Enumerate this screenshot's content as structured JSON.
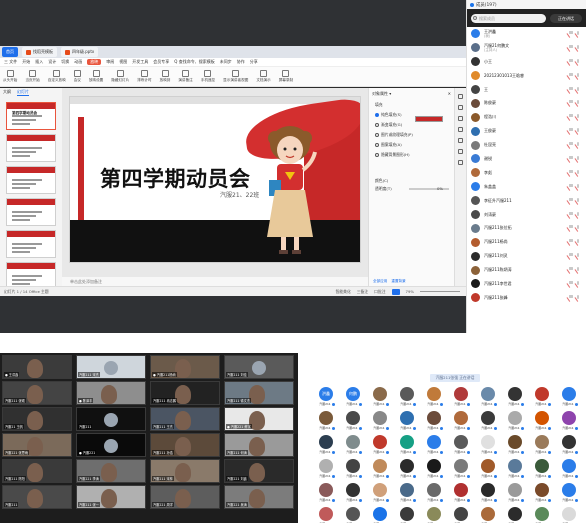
{
  "wps": {
    "tabs": [
      {
        "label": "首页",
        "kind": "home"
      },
      {
        "label": "找稻壳模板",
        "kind": "doc"
      },
      {
        "label": "四年级.pptx",
        "kind": "doc"
      }
    ],
    "menus": [
      "三 文件",
      "开始",
      "插入",
      "设计",
      "切换",
      "动画",
      "放映",
      "审阅",
      "视图",
      "开发工具",
      "会员专享",
      "Q 查找命令、搜索模板",
      "未同步",
      "协作",
      "分享"
    ],
    "menu_active_index": 6,
    "ribbon_buttons": [
      "从头开始",
      "当页开始",
      "自定义放映",
      "会议",
      "放映设置",
      "隐藏幻灯片",
      "排练计时",
      "放映到",
      "演讲备注",
      "手机遥控",
      "显示演讲者视图",
      "文档演示",
      "屏幕录制"
    ],
    "side_tabs": [
      "大纲",
      "幻灯片"
    ],
    "slide_numbers": [
      "1",
      "2",
      "3",
      "4",
      "5",
      "6"
    ],
    "thumb_titles": [
      "第四学期动员会",
      "",
      "",
      "",
      "",
      ""
    ],
    "slide": {
      "title": "第四学期动员会",
      "subtitle": "汽服21、22班"
    },
    "notes_placeholder": "单击此处添加备注",
    "right_panel": {
      "header": "对象属性 ▾",
      "fill_label": "填充",
      "options": [
        {
          "label": "纯色填充(S)",
          "on": true
        },
        {
          "label": "渐变填充(G)",
          "on": false
        },
        {
          "label": "图片或纹理填充(P)",
          "on": false
        },
        {
          "label": "图案填充(A)",
          "on": false
        },
        {
          "label": "隐藏背景图形(H)",
          "on": false
        }
      ],
      "color_label": "颜色(C)",
      "transparency_label": "透明度(T)",
      "transparency_value": "0%",
      "bottom_tabs": [
        "全部应用",
        "重置背景"
      ]
    },
    "status": {
      "left": "幻灯片 1 / 14   Office 主题",
      "right_items": [
        "智能美化",
        "三备注",
        "口批注"
      ],
      "zoom": "79% "
    }
  },
  "participants": {
    "header": "成员(197)",
    "search_placeholder": "搜索成员",
    "talk_label": "正在讲话",
    "items": [
      {
        "name": "王洪鑫",
        "sub": "(我)",
        "color": "#2b7de9"
      },
      {
        "name": "汽服21何鹏文",
        "sub": "(主持人)",
        "color": "#5b6f8a"
      },
      {
        "name": "小王",
        "sub": "",
        "color": "#333333"
      },
      {
        "name": "20212301013王晗睿",
        "sub": "",
        "color": "#e08a2a"
      },
      {
        "name": "王",
        "sub": "",
        "color": "#444444"
      },
      {
        "name": "陈俊豪",
        "sub": "",
        "color": "#6b4b3a"
      },
      {
        "name": "程浩川",
        "sub": "",
        "color": "#8b5a2b"
      },
      {
        "name": "王俊豪",
        "sub": "",
        "color": "#2f6fb0"
      },
      {
        "name": "杜昆亮",
        "sub": "",
        "color": "#7a7a7a"
      },
      {
        "name": "谢锐",
        "sub": "",
        "color": "#3a7bd5"
      },
      {
        "name": "李彪",
        "sub": "",
        "color": "#b06a3b"
      },
      {
        "name": "朱盖盖",
        "sub": "",
        "color": "#2b7de9"
      },
      {
        "name": "李征升汽服211",
        "sub": "",
        "color": "#555555"
      },
      {
        "name": "刘涛豪",
        "sub": "",
        "color": "#4a4a4a"
      },
      {
        "name": "汽服211张位拓",
        "sub": "",
        "color": "#6a7b8c"
      },
      {
        "name": "汽服211杨尚",
        "sub": "",
        "color": "#b35c2e"
      },
      {
        "name": "汽服211刘灵",
        "sub": "",
        "color": "#2c2c2c"
      },
      {
        "name": "汽服211陈炳涛",
        "sub": "",
        "color": "#8c6239"
      },
      {
        "name": "汽服211李世君",
        "sub": "",
        "color": "#1a1a1a"
      },
      {
        "name": "汽服211张峰",
        "sub": "",
        "color": "#c0392b"
      }
    ]
  },
  "video_grid": {
    "cells": [
      {
        "label": "● 王洪鑫",
        "bg": "#3b3b3b",
        "kind": "face"
      },
      {
        "label": "汽服211 宋杰",
        "bg": "#cfd6dc",
        "kind": "avatar"
      },
      {
        "label": "● 汽服211杨尚",
        "bg": "#6b5a4a",
        "kind": "face"
      },
      {
        "label": "汽服211 刘佳",
        "bg": "#5a5a5a",
        "kind": "avatar"
      },
      {
        "label": "汽服211 张硕",
        "bg": "#444444",
        "kind": "face"
      },
      {
        "label": "● 陈泽丰",
        "bg": "#8e8e8e",
        "kind": "face"
      },
      {
        "label": "汽服211 冉志鹏",
        "bg": "#222222",
        "kind": "face"
      },
      {
        "label": "汽服211 徐文杰",
        "bg": "#6d7a85",
        "kind": "face"
      },
      {
        "label": "汽服21 王帆",
        "bg": "#303030",
        "kind": "face"
      },
      {
        "label": "汽服211",
        "bg": "#101010",
        "kind": "avatar"
      },
      {
        "label": "汽服211 王杰",
        "bg": "#4b5563",
        "kind": "face"
      },
      {
        "label": "● 汽服221 黄宇",
        "bg": "#e8e8e8",
        "kind": "face"
      },
      {
        "label": "汽服221 张思雨",
        "bg": "#7b6a5a",
        "kind": "face"
      },
      {
        "label": "● 汽服221",
        "bg": "#0a0a0a",
        "kind": "avatar"
      },
      {
        "label": "汽服211 孙浩",
        "bg": "#5c4a3a",
        "kind": "face"
      },
      {
        "label": "汽服211 何涛",
        "bg": "#9a9a9a",
        "kind": "face"
      },
      {
        "label": "汽服211 陈阳",
        "bg": "#3a3a3a",
        "kind": "face"
      },
      {
        "label": "汽服221 李涛",
        "bg": "#6e6e6e",
        "kind": "face"
      },
      {
        "label": "汽服211 宋林",
        "bg": "#8a7a6a",
        "kind": "face"
      },
      {
        "label": "汽服221 刘鑫",
        "bg": "#2a2a2a",
        "kind": "face"
      },
      {
        "label": "汽服211",
        "bg": "#4a4a4a",
        "kind": "face"
      },
      {
        "label": "汽服211 张一",
        "bg": "#b0b0b0",
        "kind": "face"
      },
      {
        "label": "汽服221 周洋",
        "bg": "#5d5d5d",
        "kind": "face"
      },
      {
        "label": "汽服221 吴涛",
        "bg": "#7c7c7c",
        "kind": "face"
      }
    ]
  },
  "gallery": {
    "tag": "汽服211张强 正在讲话",
    "cells": [
      {
        "text": "洪鑫",
        "color": "#2b7de9"
      },
      {
        "text": "何鹏",
        "color": "#2b7de9"
      },
      {
        "text": "",
        "color": "#8a6a4a"
      },
      {
        "text": "",
        "color": "#5a5a5a"
      },
      {
        "text": "",
        "color": "#c07a3a"
      },
      {
        "text": "",
        "color": "#b03a3a"
      },
      {
        "text": "",
        "color": "#6a8aaa"
      },
      {
        "text": "",
        "color": "#333333"
      },
      {
        "text": "",
        "color": "#c0392b"
      },
      {
        "text": "",
        "color": "#2b7de9"
      },
      {
        "text": "",
        "color": "#7a5a3a"
      },
      {
        "text": "",
        "color": "#4a4a4a"
      },
      {
        "text": "",
        "color": "#888888"
      },
      {
        "text": "",
        "color": "#2e6fb0"
      },
      {
        "text": "",
        "color": "#6b4b3a"
      },
      {
        "text": "",
        "color": "#b06a3b"
      },
      {
        "text": "",
        "color": "#3a3a3a"
      },
      {
        "text": "",
        "color": "#aaaaaa"
      },
      {
        "text": "",
        "color": "#d35400"
      },
      {
        "text": "",
        "color": "#8e44ad"
      },
      {
        "text": "",
        "color": "#2c3e50"
      },
      {
        "text": "",
        "color": "#7f8c8d"
      },
      {
        "text": "",
        "color": "#c0392b"
      },
      {
        "text": "",
        "color": "#16a085"
      },
      {
        "text": "",
        "color": "#2b7de9"
      },
      {
        "text": "",
        "color": "#5a5a5a"
      },
      {
        "text": "",
        "color": "#e0e0e0"
      },
      {
        "text": "",
        "color": "#6a4a2a"
      },
      {
        "text": "",
        "color": "#9a7a5a"
      },
      {
        "text": "",
        "color": "#333333"
      },
      {
        "text": "",
        "color": "#b0b0b0"
      },
      {
        "text": "",
        "color": "#444444"
      },
      {
        "text": "",
        "color": "#c08a5a"
      },
      {
        "text": "",
        "color": "#2b2b2b"
      },
      {
        "text": "",
        "color": "#1a1a1a"
      },
      {
        "text": "",
        "color": "#7a7a7a"
      },
      {
        "text": "",
        "color": "#a05a2a"
      },
      {
        "text": "",
        "color": "#5a7a9a"
      },
      {
        "text": "",
        "color": "#3a5a3a"
      },
      {
        "text": "",
        "color": "#2b7de9"
      },
      {
        "text": "",
        "color": "#8a5a5a"
      },
      {
        "text": "",
        "color": "#333333"
      },
      {
        "text": "",
        "color": "#d0a07a"
      },
      {
        "text": "",
        "color": "#4a6a8a"
      },
      {
        "text": "",
        "color": "#6a6a6a"
      },
      {
        "text": "",
        "color": "#b03030"
      },
      {
        "text": "",
        "color": "#2a2a2a"
      },
      {
        "text": "",
        "color": "#9a9a9a"
      },
      {
        "text": "",
        "color": "#7a4a2a"
      },
      {
        "text": "",
        "color": "#2b7de9"
      },
      {
        "text": "",
        "color": "#c05a5a"
      },
      {
        "text": "",
        "color": "#555555"
      },
      {
        "text": "",
        "color": "#1a73e8"
      },
      {
        "text": "",
        "color": "#3a3a3a"
      },
      {
        "text": "",
        "color": "#8a8a5a"
      },
      {
        "text": "",
        "color": "#444444"
      },
      {
        "text": "",
        "color": "#aa6a3a"
      },
      {
        "text": "",
        "color": "#2b2b2b"
      },
      {
        "text": "",
        "color": "#5a8a5a"
      },
      {
        "text": "",
        "color": "#dadada"
      },
      {
        "text": "",
        "color": "#333333"
      },
      {
        "text": "",
        "color": "#a0a0a0"
      },
      {
        "text": "",
        "color": "#6a3a2a"
      },
      {
        "text": "",
        "color": "#c07a4a"
      },
      {
        "text": "",
        "color": "#2b7de9"
      },
      {
        "text": "",
        "color": "#7a7a7a"
      },
      {
        "text": "",
        "color": "#2a2a2a"
      },
      {
        "text": "",
        "color": "#bb4444"
      },
      {
        "text": "",
        "color": "#555555"
      },
      {
        "text": "",
        "color": "#8a6a4a"
      },
      {
        "text": "",
        "color": "#3a6a9a"
      },
      {
        "text": "",
        "color": "#111111"
      },
      {
        "text": "",
        "color": "#999999"
      },
      {
        "text": "",
        "color": "#5a5a5a"
      },
      {
        "text": "",
        "color": "#2b7de9"
      },
      {
        "text": "",
        "color": "#c0392b"
      },
      {
        "text": "",
        "color": "#333333"
      },
      {
        "text": "",
        "color": "#7a5a3a"
      },
      {
        "text": "",
        "color": "#ababab"
      },
      {
        "text": "",
        "color": "#4a4a4a"
      }
    ],
    "name_prefix": "汽服211"
  }
}
